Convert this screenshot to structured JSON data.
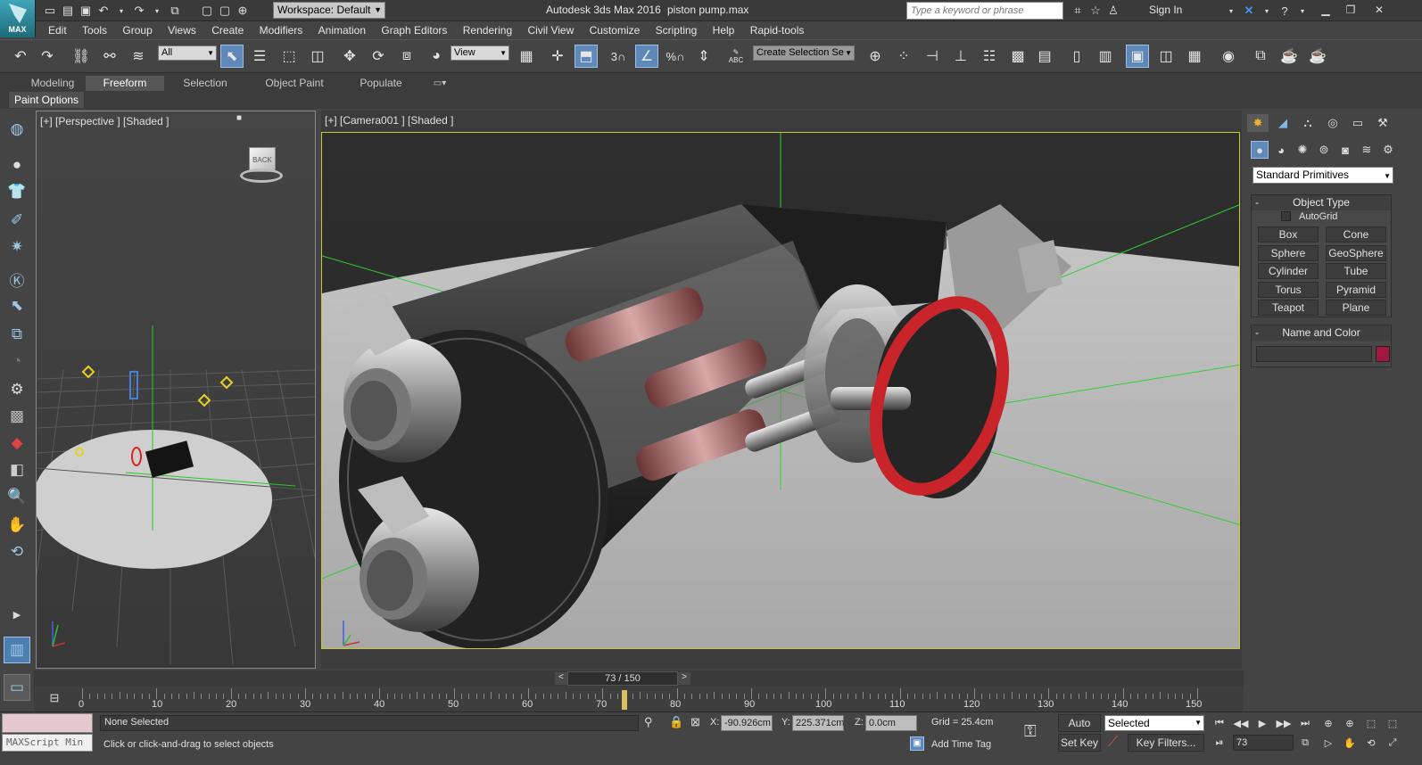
{
  "title": {
    "app_logo": "MAX",
    "workspace": "Workspace: Default",
    "app_name": "Autodesk 3ds Max 2016",
    "file_name": "piston pump.max",
    "search_placeholder": "Type a keyword or phrase",
    "sign_in": "Sign In"
  },
  "menu": [
    "Edit",
    "Tools",
    "Group",
    "Views",
    "Create",
    "Modifiers",
    "Animation",
    "Graph Editors",
    "Rendering",
    "Civil View",
    "Customize",
    "Scripting",
    "Help",
    "Rapid-tools"
  ],
  "toolbar": {
    "filter_value": "All",
    "coord_value": "View",
    "selection_set_placeholder": "Create Selection Se",
    "snap_label": "3",
    "angle_snap_label": "%",
    "abc_label": "ABC"
  },
  "ribbon": {
    "tabs": [
      "Modeling",
      "Freeform",
      "Selection",
      "Object Paint",
      "Populate"
    ],
    "active_tab": "Freeform",
    "sub_label": "Paint Options"
  },
  "viewports": {
    "left_label": "[+] [Perspective ] [Shaded ]",
    "main_label": "[+] [Camera001 ] [Shaded ]",
    "viewcube_face": "BACK"
  },
  "command_panel": {
    "dropdown": "Standard Primitives",
    "object_type_header": "Object Type",
    "autogrid": "AutoGrid",
    "buttons": [
      "Box",
      "Cone",
      "Sphere",
      "GeoSphere",
      "Cylinder",
      "Tube",
      "Torus",
      "Pyramid",
      "Teapot",
      "Plane"
    ],
    "name_color_header": "Name and Color",
    "object_color": "#a01840"
  },
  "timeline": {
    "frame_display": "73 / 150",
    "ticks": [
      "0",
      "10",
      "20",
      "30",
      "40",
      "50",
      "60",
      "70",
      "80",
      "90",
      "100",
      "110",
      "120",
      "130",
      "140",
      "150"
    ]
  },
  "status": {
    "maxscript": "MAXScript Min",
    "selection": "None Selected",
    "prompt": "Click or click-and-drag to select objects",
    "x_label": "X:",
    "x_value": "-90.926cm",
    "y_label": "Y:",
    "y_value": "225.371cm",
    "z_label": "Z:",
    "z_value": "0.0cm",
    "grid": "Grid = 25.4cm",
    "add_time_tag": "Add Time Tag",
    "auto_key": "Auto Key",
    "set_key": "Set Key",
    "key_mode": "Selected",
    "key_filters": "Key Filters...",
    "current_frame": "73"
  },
  "colors": {
    "accent": "#5d88b8",
    "camera_frame": "#c8c832",
    "grid_green": "#2fd02f",
    "ring_red": "#c8242a"
  }
}
